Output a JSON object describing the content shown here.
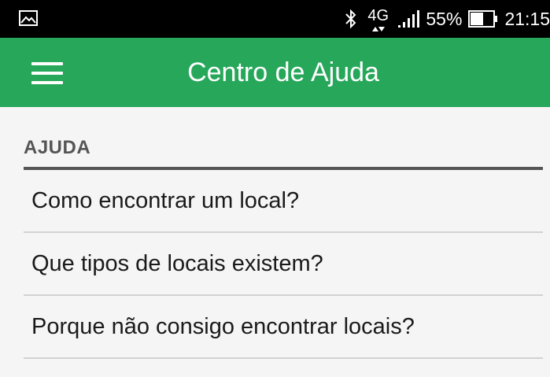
{
  "status_bar": {
    "icons": [
      "gallery-icon",
      "bluetooth-icon",
      "signal-icon",
      "battery-icon"
    ],
    "network": "4G",
    "battery": "55%",
    "time": "21:15"
  },
  "app_bar": {
    "title": "Centro de Ajuda",
    "menu_icon": "hamburger-menu-icon",
    "color": "#27a75a"
  },
  "help": {
    "section_title": "AJUDA",
    "items": [
      {
        "label": "Como encontrar um local?"
      },
      {
        "label": "Que tipos de locais existem?"
      },
      {
        "label": "Porque não consigo encontrar locais?"
      }
    ]
  }
}
